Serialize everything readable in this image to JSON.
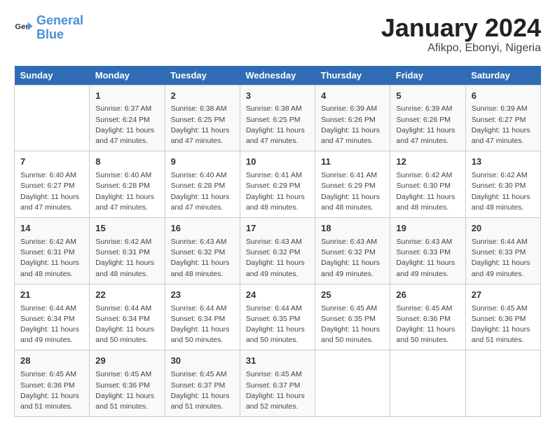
{
  "logo": {
    "line1": "General",
    "line2": "Blue"
  },
  "title": "January 2024",
  "subtitle": "Afikpo, Ebonyi, Nigeria",
  "days_of_week": [
    "Sunday",
    "Monday",
    "Tuesday",
    "Wednesday",
    "Thursday",
    "Friday",
    "Saturday"
  ],
  "weeks": [
    [
      {
        "day": "",
        "info": ""
      },
      {
        "day": "1",
        "info": "Sunrise: 6:37 AM\nSunset: 6:24 PM\nDaylight: 11 hours\nand 47 minutes."
      },
      {
        "day": "2",
        "info": "Sunrise: 6:38 AM\nSunset: 6:25 PM\nDaylight: 11 hours\nand 47 minutes."
      },
      {
        "day": "3",
        "info": "Sunrise: 6:38 AM\nSunset: 6:25 PM\nDaylight: 11 hours\nand 47 minutes."
      },
      {
        "day": "4",
        "info": "Sunrise: 6:39 AM\nSunset: 6:26 PM\nDaylight: 11 hours\nand 47 minutes."
      },
      {
        "day": "5",
        "info": "Sunrise: 6:39 AM\nSunset: 6:26 PM\nDaylight: 11 hours\nand 47 minutes."
      },
      {
        "day": "6",
        "info": "Sunrise: 6:39 AM\nSunset: 6:27 PM\nDaylight: 11 hours\nand 47 minutes."
      }
    ],
    [
      {
        "day": "7",
        "info": "Sunrise: 6:40 AM\nSunset: 6:27 PM\nDaylight: 11 hours\nand 47 minutes."
      },
      {
        "day": "8",
        "info": "Sunrise: 6:40 AM\nSunset: 6:28 PM\nDaylight: 11 hours\nand 47 minutes."
      },
      {
        "day": "9",
        "info": "Sunrise: 6:40 AM\nSunset: 6:28 PM\nDaylight: 11 hours\nand 47 minutes."
      },
      {
        "day": "10",
        "info": "Sunrise: 6:41 AM\nSunset: 6:29 PM\nDaylight: 11 hours\nand 48 minutes."
      },
      {
        "day": "11",
        "info": "Sunrise: 6:41 AM\nSunset: 6:29 PM\nDaylight: 11 hours\nand 48 minutes."
      },
      {
        "day": "12",
        "info": "Sunrise: 6:42 AM\nSunset: 6:30 PM\nDaylight: 11 hours\nand 48 minutes."
      },
      {
        "day": "13",
        "info": "Sunrise: 6:42 AM\nSunset: 6:30 PM\nDaylight: 11 hours\nand 48 minutes."
      }
    ],
    [
      {
        "day": "14",
        "info": "Sunrise: 6:42 AM\nSunset: 6:31 PM\nDaylight: 11 hours\nand 48 minutes."
      },
      {
        "day": "15",
        "info": "Sunrise: 6:42 AM\nSunset: 6:31 PM\nDaylight: 11 hours\nand 48 minutes."
      },
      {
        "day": "16",
        "info": "Sunrise: 6:43 AM\nSunset: 6:32 PM\nDaylight: 11 hours\nand 48 minutes."
      },
      {
        "day": "17",
        "info": "Sunrise: 6:43 AM\nSunset: 6:32 PM\nDaylight: 11 hours\nand 49 minutes."
      },
      {
        "day": "18",
        "info": "Sunrise: 6:43 AM\nSunset: 6:32 PM\nDaylight: 11 hours\nand 49 minutes."
      },
      {
        "day": "19",
        "info": "Sunrise: 6:43 AM\nSunset: 6:33 PM\nDaylight: 11 hours\nand 49 minutes."
      },
      {
        "day": "20",
        "info": "Sunrise: 6:44 AM\nSunset: 6:33 PM\nDaylight: 11 hours\nand 49 minutes."
      }
    ],
    [
      {
        "day": "21",
        "info": "Sunrise: 6:44 AM\nSunset: 6:34 PM\nDaylight: 11 hours\nand 49 minutes."
      },
      {
        "day": "22",
        "info": "Sunrise: 6:44 AM\nSunset: 6:34 PM\nDaylight: 11 hours\nand 50 minutes."
      },
      {
        "day": "23",
        "info": "Sunrise: 6:44 AM\nSunset: 6:34 PM\nDaylight: 11 hours\nand 50 minutes."
      },
      {
        "day": "24",
        "info": "Sunrise: 6:44 AM\nSunset: 6:35 PM\nDaylight: 11 hours\nand 50 minutes."
      },
      {
        "day": "25",
        "info": "Sunrise: 6:45 AM\nSunset: 6:35 PM\nDaylight: 11 hours\nand 50 minutes."
      },
      {
        "day": "26",
        "info": "Sunrise: 6:45 AM\nSunset: 6:36 PM\nDaylight: 11 hours\nand 50 minutes."
      },
      {
        "day": "27",
        "info": "Sunrise: 6:45 AM\nSunset: 6:36 PM\nDaylight: 11 hours\nand 51 minutes."
      }
    ],
    [
      {
        "day": "28",
        "info": "Sunrise: 6:45 AM\nSunset: 6:36 PM\nDaylight: 11 hours\nand 51 minutes."
      },
      {
        "day": "29",
        "info": "Sunrise: 6:45 AM\nSunset: 6:36 PM\nDaylight: 11 hours\nand 51 minutes."
      },
      {
        "day": "30",
        "info": "Sunrise: 6:45 AM\nSunset: 6:37 PM\nDaylight: 11 hours\nand 51 minutes."
      },
      {
        "day": "31",
        "info": "Sunrise: 6:45 AM\nSunset: 6:37 PM\nDaylight: 11 hours\nand 52 minutes."
      },
      {
        "day": "",
        "info": ""
      },
      {
        "day": "",
        "info": ""
      },
      {
        "day": "",
        "info": ""
      }
    ]
  ]
}
